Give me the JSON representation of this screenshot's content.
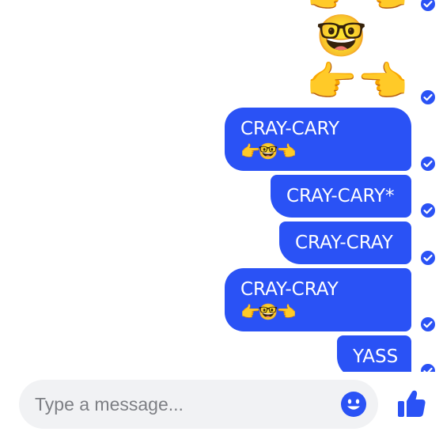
{
  "messages": [
    {
      "type": "emoji",
      "text": "👉👈"
    },
    {
      "type": "emoji",
      "text": "🤓"
    },
    {
      "type": "emoji",
      "text": "👉👈"
    },
    {
      "type": "text",
      "text": "CRAY-CARY",
      "emoji": "👉🤓👈"
    },
    {
      "type": "text",
      "text": "CRAY-CARY*"
    },
    {
      "type": "text",
      "text": "CRAY-CRAY"
    },
    {
      "type": "text",
      "text": "CRAY-CRAY",
      "emoji": "👉🤓👈"
    },
    {
      "type": "text",
      "text": "YASS"
    }
  ],
  "composer": {
    "placeholder": "Type a message..."
  },
  "colors": {
    "bubble": "#2a52f5",
    "composer_bg": "#f1f2f4",
    "accent": "#2a52f5"
  },
  "icons": {
    "emoji_button": "smiley-icon",
    "like_button": "thumbs-up-icon",
    "sent": "check-circle-icon"
  }
}
